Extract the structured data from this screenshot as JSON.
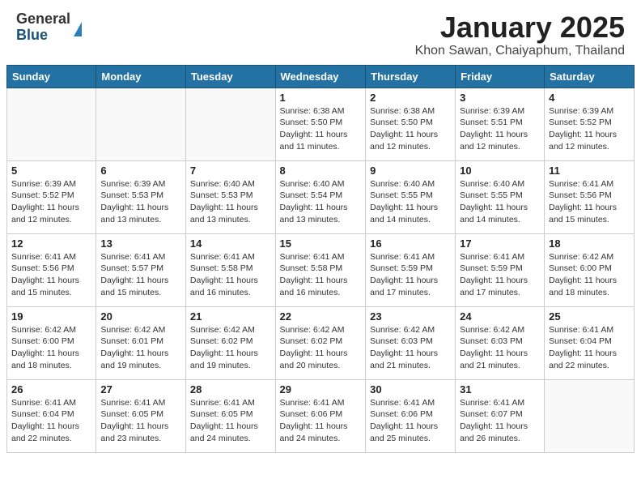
{
  "header": {
    "logo_general": "General",
    "logo_blue": "Blue",
    "title": "January 2025",
    "location": "Khon Sawan, Chaiyaphum, Thailand"
  },
  "weekdays": [
    "Sunday",
    "Monday",
    "Tuesday",
    "Wednesday",
    "Thursday",
    "Friday",
    "Saturday"
  ],
  "weeks": [
    [
      {
        "day": "",
        "info": ""
      },
      {
        "day": "",
        "info": ""
      },
      {
        "day": "",
        "info": ""
      },
      {
        "day": "1",
        "info": "Sunrise: 6:38 AM\nSunset: 5:50 PM\nDaylight: 11 hours\nand 11 minutes."
      },
      {
        "day": "2",
        "info": "Sunrise: 6:38 AM\nSunset: 5:50 PM\nDaylight: 11 hours\nand 12 minutes."
      },
      {
        "day": "3",
        "info": "Sunrise: 6:39 AM\nSunset: 5:51 PM\nDaylight: 11 hours\nand 12 minutes."
      },
      {
        "day": "4",
        "info": "Sunrise: 6:39 AM\nSunset: 5:52 PM\nDaylight: 11 hours\nand 12 minutes."
      }
    ],
    [
      {
        "day": "5",
        "info": "Sunrise: 6:39 AM\nSunset: 5:52 PM\nDaylight: 11 hours\nand 12 minutes."
      },
      {
        "day": "6",
        "info": "Sunrise: 6:39 AM\nSunset: 5:53 PM\nDaylight: 11 hours\nand 13 minutes."
      },
      {
        "day": "7",
        "info": "Sunrise: 6:40 AM\nSunset: 5:53 PM\nDaylight: 11 hours\nand 13 minutes."
      },
      {
        "day": "8",
        "info": "Sunrise: 6:40 AM\nSunset: 5:54 PM\nDaylight: 11 hours\nand 13 minutes."
      },
      {
        "day": "9",
        "info": "Sunrise: 6:40 AM\nSunset: 5:55 PM\nDaylight: 11 hours\nand 14 minutes."
      },
      {
        "day": "10",
        "info": "Sunrise: 6:40 AM\nSunset: 5:55 PM\nDaylight: 11 hours\nand 14 minutes."
      },
      {
        "day": "11",
        "info": "Sunrise: 6:41 AM\nSunset: 5:56 PM\nDaylight: 11 hours\nand 15 minutes."
      }
    ],
    [
      {
        "day": "12",
        "info": "Sunrise: 6:41 AM\nSunset: 5:56 PM\nDaylight: 11 hours\nand 15 minutes."
      },
      {
        "day": "13",
        "info": "Sunrise: 6:41 AM\nSunset: 5:57 PM\nDaylight: 11 hours\nand 15 minutes."
      },
      {
        "day": "14",
        "info": "Sunrise: 6:41 AM\nSunset: 5:58 PM\nDaylight: 11 hours\nand 16 minutes."
      },
      {
        "day": "15",
        "info": "Sunrise: 6:41 AM\nSunset: 5:58 PM\nDaylight: 11 hours\nand 16 minutes."
      },
      {
        "day": "16",
        "info": "Sunrise: 6:41 AM\nSunset: 5:59 PM\nDaylight: 11 hours\nand 17 minutes."
      },
      {
        "day": "17",
        "info": "Sunrise: 6:41 AM\nSunset: 5:59 PM\nDaylight: 11 hours\nand 17 minutes."
      },
      {
        "day": "18",
        "info": "Sunrise: 6:42 AM\nSunset: 6:00 PM\nDaylight: 11 hours\nand 18 minutes."
      }
    ],
    [
      {
        "day": "19",
        "info": "Sunrise: 6:42 AM\nSunset: 6:00 PM\nDaylight: 11 hours\nand 18 minutes."
      },
      {
        "day": "20",
        "info": "Sunrise: 6:42 AM\nSunset: 6:01 PM\nDaylight: 11 hours\nand 19 minutes."
      },
      {
        "day": "21",
        "info": "Sunrise: 6:42 AM\nSunset: 6:02 PM\nDaylight: 11 hours\nand 19 minutes."
      },
      {
        "day": "22",
        "info": "Sunrise: 6:42 AM\nSunset: 6:02 PM\nDaylight: 11 hours\nand 20 minutes."
      },
      {
        "day": "23",
        "info": "Sunrise: 6:42 AM\nSunset: 6:03 PM\nDaylight: 11 hours\nand 21 minutes."
      },
      {
        "day": "24",
        "info": "Sunrise: 6:42 AM\nSunset: 6:03 PM\nDaylight: 11 hours\nand 21 minutes."
      },
      {
        "day": "25",
        "info": "Sunrise: 6:41 AM\nSunset: 6:04 PM\nDaylight: 11 hours\nand 22 minutes."
      }
    ],
    [
      {
        "day": "26",
        "info": "Sunrise: 6:41 AM\nSunset: 6:04 PM\nDaylight: 11 hours\nand 22 minutes."
      },
      {
        "day": "27",
        "info": "Sunrise: 6:41 AM\nSunset: 6:05 PM\nDaylight: 11 hours\nand 23 minutes."
      },
      {
        "day": "28",
        "info": "Sunrise: 6:41 AM\nSunset: 6:05 PM\nDaylight: 11 hours\nand 24 minutes."
      },
      {
        "day": "29",
        "info": "Sunrise: 6:41 AM\nSunset: 6:06 PM\nDaylight: 11 hours\nand 24 minutes."
      },
      {
        "day": "30",
        "info": "Sunrise: 6:41 AM\nSunset: 6:06 PM\nDaylight: 11 hours\nand 25 minutes."
      },
      {
        "day": "31",
        "info": "Sunrise: 6:41 AM\nSunset: 6:07 PM\nDaylight: 11 hours\nand 26 minutes."
      },
      {
        "day": "",
        "info": ""
      }
    ]
  ]
}
